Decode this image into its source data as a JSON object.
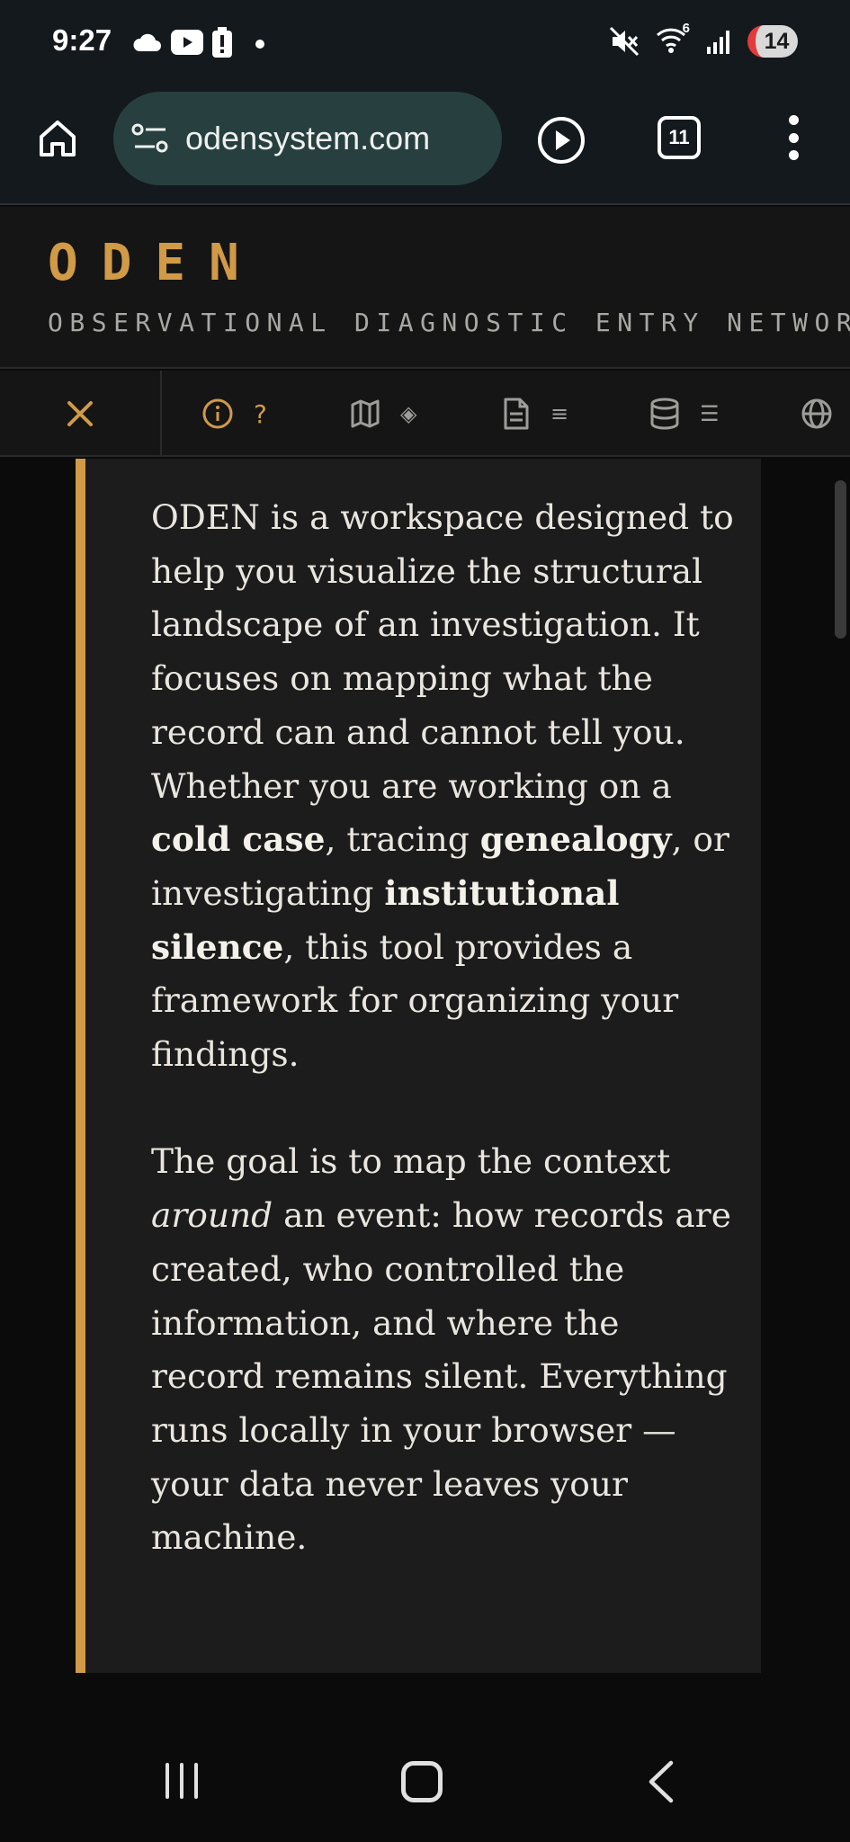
{
  "status_bar": {
    "time": "9:27",
    "left_icons": [
      "cloud-icon",
      "youtube-icon",
      "alert-battery-icon",
      "dot-icon"
    ],
    "right_icons": [
      "mute-icon",
      "wifi-icon",
      "signal-icon"
    ],
    "wifi_label": "6",
    "battery_level": "14",
    "battery_low_color": "#e23b3b"
  },
  "browser": {
    "url": "odensystem.com",
    "tab_count": "11",
    "accent_color": "#27403f"
  },
  "site": {
    "logo": "ODEN",
    "tagline": "OBSERVATIONAL DIAGNOSTIC ENTRY NETWORK",
    "accent_color": "#d19a47"
  },
  "nav": {
    "close_icon": "close-icon",
    "items": [
      {
        "icon": "info-icon",
        "glyph": "?"
      },
      {
        "icon": "map-icon",
        "glyph": "◈"
      },
      {
        "icon": "document-icon",
        "glyph": "≡"
      },
      {
        "icon": "database-icon",
        "glyph": "☰"
      },
      {
        "icon": "globe-icon",
        "glyph": ""
      }
    ]
  },
  "content": {
    "p1_a": "ODEN is a workspace designed to help you visualize the structural landscape of an investigation. It focuses on mapping what the record can and cannot tell you. Whether you are working on a ",
    "p1_b1": "cold case",
    "p1_c": ", tracing ",
    "p1_b2": "genealogy",
    "p1_d": ", or investigating ",
    "p1_b3": "institutional silence",
    "p1_e": ", this tool provides a framework for organizing your findings.",
    "p2_a": "The goal is to map the context ",
    "p2_i": "around",
    "p2_b": " an event: how records are created, who controlled the information, and where the record remains silent. Everything runs locally in your browser — your data never leaves your machine."
  }
}
